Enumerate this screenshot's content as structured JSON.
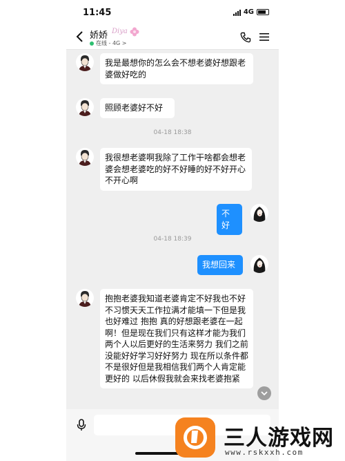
{
  "status_bar": {
    "time": "11:45",
    "network": "4G"
  },
  "header": {
    "contact_name": "娇娇",
    "name_decoration": "Diya",
    "status": "在线 - 4G >",
    "icons": [
      "back-chevron-icon",
      "phone-icon",
      "menu-icon"
    ]
  },
  "messages": [
    {
      "type": "received",
      "text": "我是最想你的怎么会不想老婆好想跟老婆做好吃的"
    },
    {
      "type": "received",
      "text": "照顾老婆好不好"
    },
    {
      "type": "timestamp",
      "text": "04-18 18:38"
    },
    {
      "type": "received",
      "text": "我很想老婆啊我除了工作干啥都会想老婆会想老婆吃的好不好睡的好不好开心不开心啊"
    },
    {
      "type": "sent",
      "text": "不好"
    },
    {
      "type": "timestamp",
      "text": "04-18 18:39"
    },
    {
      "type": "sent",
      "text": "我想回来"
    },
    {
      "type": "received",
      "text": "抱抱老婆我知道老婆肯定不好我也不好不习惯天天工作拉满才能填一下但是我也好难过 抱抱 真的好想跟老婆在一起啊！但是现在我们只有这样才能为我们两个人以后更好的生活来努力 我们之前没能好好学习好好努力 现在所以条件都不是很好但是我相信我们两个人肯定能更好的 以后休假我就会来找老婆抱紧"
    }
  ],
  "input_bar": {
    "placeholder": "",
    "mic_icon": "microphone-icon"
  },
  "watermark": {
    "title": "三人游戏网",
    "url": "www.rskxxh.com"
  },
  "colors": {
    "sent_bubble": "#1e90ff",
    "received_bubble": "#ffffff",
    "background": "#efefef",
    "online": "#2fbf71",
    "watermark_orange": "#f5821f"
  }
}
